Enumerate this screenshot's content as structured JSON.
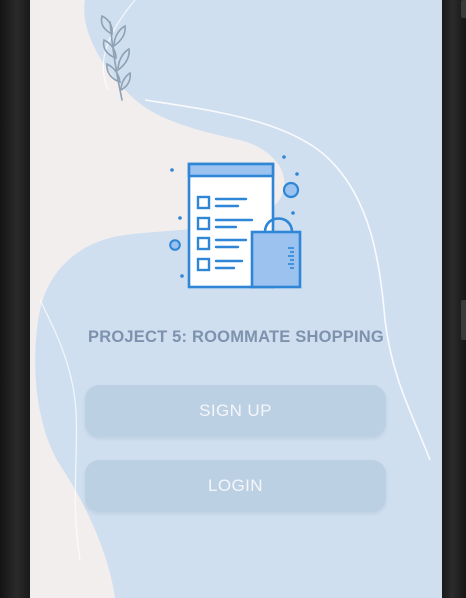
{
  "app": {
    "title": "PROJECT 5: ROOMMATE SHOPPING"
  },
  "actions": {
    "signup_label": "SIGN UP",
    "login_label": "LOGIN"
  },
  "icons": {
    "hero": "shopping-list-bag-icon",
    "decoration": "leaf-branch-icon"
  },
  "colors": {
    "background": "#f2eeed",
    "blob": "#cfdff0",
    "title": "#7f92ad",
    "button": "#bcd0e4",
    "button_text": "#f4f6fa",
    "icon_stroke": "#2f86d6",
    "icon_fill": "#9cc2f0"
  }
}
